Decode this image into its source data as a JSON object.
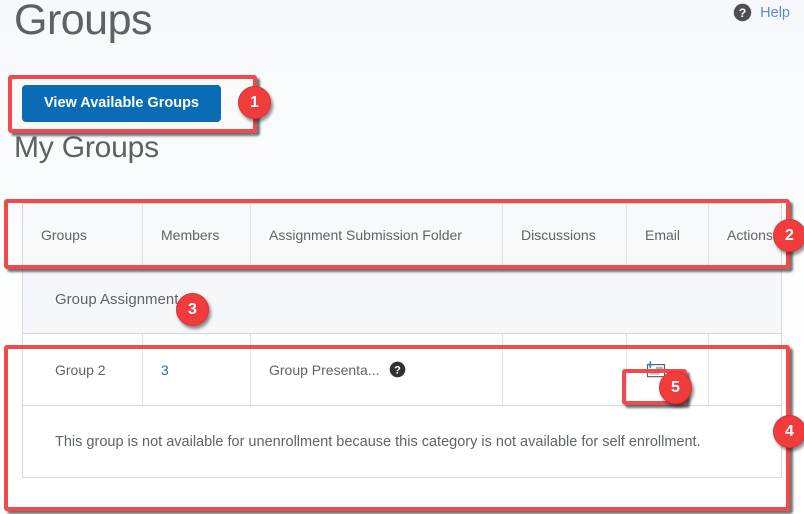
{
  "header": {
    "title": "Groups",
    "help_label": "Help",
    "help_icon": "question-circle-icon"
  },
  "toolbar": {
    "view_available_groups_label": "View Available Groups",
    "primary_color": "#0a6cb4"
  },
  "my_groups": {
    "heading": "My Groups"
  },
  "table": {
    "columns": [
      "Groups",
      "Members",
      "Assignment Submission Folder",
      "Discussions",
      "Email",
      "Actions"
    ],
    "category_row": {
      "label": "Group Assignment"
    },
    "rows": [
      {
        "group": "Group 2",
        "members": "3",
        "folder": "Group Presenta...",
        "folder_icon": "question-circle-icon",
        "discussions": "",
        "email_icon": "email-envelope-icon",
        "actions": ""
      }
    ],
    "notice": "This group is not available for unenrollment because this category is not available for self enrollment."
  },
  "annotations": {
    "badge_color": "#f03c3c",
    "box_color": "#f04a4a",
    "items": [
      {
        "number": "1",
        "target": "view-available-groups-button"
      },
      {
        "number": "2",
        "target": "table-header-row"
      },
      {
        "number": "3",
        "target": "group-category-row"
      },
      {
        "number": "4",
        "target": "group-row-block"
      },
      {
        "number": "5",
        "target": "email-icon-button"
      }
    ]
  }
}
